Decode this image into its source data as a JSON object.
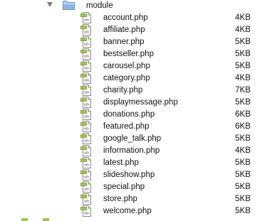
{
  "folder": {
    "name": "module",
    "icon": "folder-icon",
    "expanded": true
  },
  "files": [
    {
      "name": "account.php",
      "size": "4KB"
    },
    {
      "name": "affiliate.php",
      "size": "4KB"
    },
    {
      "name": "banner.php",
      "size": "5KB"
    },
    {
      "name": "bestseller.php",
      "size": "5KB"
    },
    {
      "name": "carousel.php",
      "size": "5KB"
    },
    {
      "name": "category.php",
      "size": "4KB"
    },
    {
      "name": "charity.php",
      "size": "7KB"
    },
    {
      "name": "displaymessage.php",
      "size": "5KB"
    },
    {
      "name": "donations.php",
      "size": "6KB"
    },
    {
      "name": "featured.php",
      "size": "6KB"
    },
    {
      "name": "google_talk.php",
      "size": "5KB"
    },
    {
      "name": "information.php",
      "size": "4KB"
    },
    {
      "name": "latest.php",
      "size": "5KB"
    },
    {
      "name": "slideshow.php",
      "size": "5KB"
    },
    {
      "name": "special.php",
      "size": "5KB"
    },
    {
      "name": "store.php",
      "size": "5KB"
    },
    {
      "name": "welcome.php",
      "size": "5KB"
    }
  ],
  "file_icon": "php-file-icon",
  "colors": {
    "folder_blue": "#8cb4e8",
    "disclosure_gray": "#7a7a7a",
    "file_icon_green": "#8fbf3f"
  }
}
